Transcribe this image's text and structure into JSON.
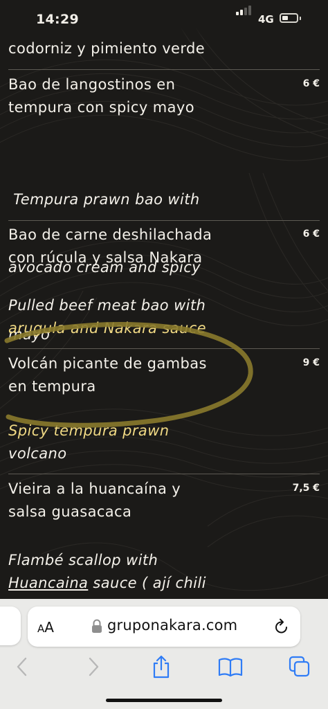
{
  "status_bar": {
    "time": "14:29",
    "network": "4G",
    "signal_bars_active": 2,
    "signal_bars_total": 4,
    "battery_level": 0.25
  },
  "menu": {
    "top_fragment": "codorniz y pimiento verde",
    "items": [
      {
        "es_lines": [
          "Bao de langostinos en",
          "tempura con spicy mayo"
        ],
        "price": "6 €",
        "en_lines": [
          " Tempura prawn bao with",
          "avocado cream and spicy",
          "mayo"
        ]
      },
      {
        "es_lines": [
          "Bao de carne deshilachada",
          "con rúcula y salsa Nakara"
        ],
        "price": "6 €",
        "en_lines": [
          "Pulled beef meat bao with",
          "arugula and Nakara sauce"
        ]
      },
      {
        "es_lines": [
          "Volcán picante de gambas",
          "en tempura"
        ],
        "price": "9 €",
        "en_lines": [
          "Spicy tempura prawn",
          "volcano"
        ]
      },
      {
        "es_lines": [
          "Vieira a la huancaína y",
          "salsa guasacaca"
        ],
        "price": "7,5 €",
        "en_line1": "Flambé scallop with",
        "en_underlined": "Huancaina",
        "en_line2_rest": " sauce ( ají chili"
      }
    ]
  },
  "browser": {
    "aa_small": "A",
    "aa_big": "A",
    "url": "gruponakara.com",
    "icons": [
      "lock-icon",
      "reload-icon",
      "back-icon",
      "forward-icon",
      "share-icon",
      "bookmarks-icon",
      "tabs-icon"
    ]
  },
  "colors": {
    "background": "#1b1a18",
    "text": "#f4f1ea",
    "highlight": "#f0d984",
    "annotation": "#8a7a2c",
    "browser_accent": "#2f7cf6"
  }
}
